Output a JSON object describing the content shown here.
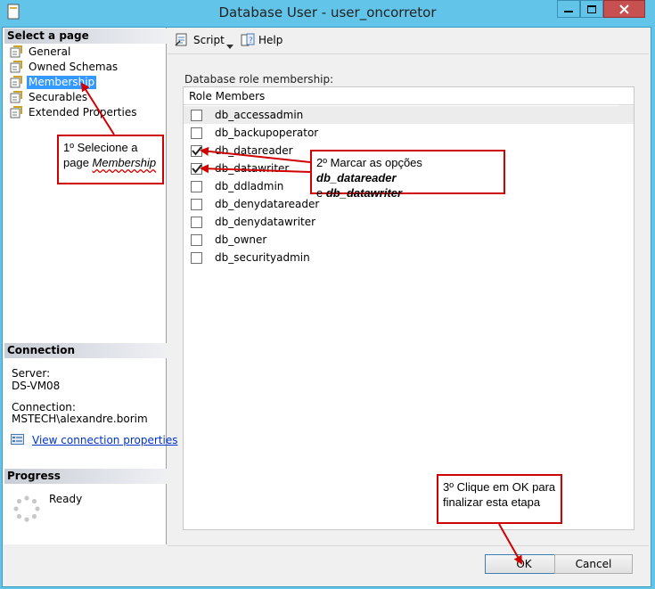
{
  "window": {
    "title": "Database User - user_oncorretor",
    "controls": {
      "minimize": "—",
      "maximize": "☐",
      "close": "✕"
    }
  },
  "left_pane": {
    "select_page_header": "Select a page",
    "pages": [
      {
        "label": "General",
        "icon": "page-icon"
      },
      {
        "label": "Owned Schemas",
        "icon": "page-icon"
      },
      {
        "label": "Membership",
        "icon": "page-icon",
        "selected": true
      },
      {
        "label": "Securables",
        "icon": "page-icon"
      },
      {
        "label": "Extended Properties",
        "icon": "page-icon"
      }
    ],
    "connection_header": "Connection",
    "server_label": "Server:",
    "server_value": "DS-VM08",
    "connection_label": "Connection:",
    "connection_value": "MSTECH\\alexandre.borim",
    "view_connection_link": "View connection properties",
    "progress_header": "Progress",
    "progress_status": "Ready"
  },
  "toolbar": {
    "script_label": "Script",
    "help_label": "Help"
  },
  "main": {
    "membership_label": "Database role membership:",
    "column_header": "Role Members",
    "roles": [
      {
        "name": "db_accessadmin",
        "checked": false,
        "selected": true
      },
      {
        "name": "db_backupoperator",
        "checked": false
      },
      {
        "name": "db_datareader",
        "checked": true
      },
      {
        "name": "db_datawriter",
        "checked": true
      },
      {
        "name": "db_ddladmin",
        "checked": false
      },
      {
        "name": "db_denydatareader",
        "checked": false
      },
      {
        "name": "db_denydatawriter",
        "checked": false
      },
      {
        "name": "db_owner",
        "checked": false
      },
      {
        "name": "db_securityadmin",
        "checked": false
      }
    ]
  },
  "footer": {
    "ok_label": "OK",
    "cancel_label": "Cancel"
  },
  "annotations": {
    "step1_text": "1º Selecione a page ",
    "step1_emph": "Membership",
    "step2_text_a": "2º Marcar as opções ",
    "step2_emph_a": "db_datareader",
    "step2_text_b": "e ",
    "step2_emph_b": "db_datawriter",
    "step3_text": "3º Clique em OK para finalizar esta etapa",
    "callout_color": "#d10000"
  },
  "colors": {
    "titlebar": "#62c4e8",
    "selection": "#3399ff",
    "link": "#0033cc"
  }
}
